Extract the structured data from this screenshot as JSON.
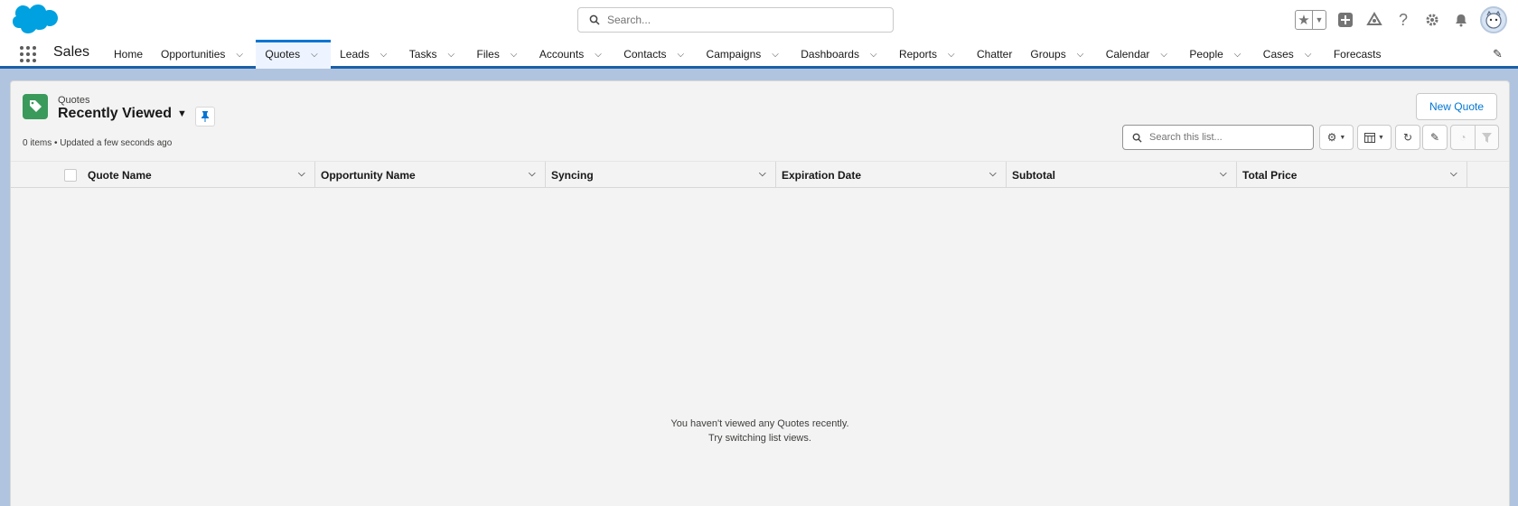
{
  "header": {
    "search_placeholder": "Search..."
  },
  "nav": {
    "app_name": "Sales",
    "items": [
      {
        "label": "Home",
        "has_menu": false,
        "active": false
      },
      {
        "label": "Opportunities",
        "has_menu": true,
        "active": false
      },
      {
        "label": "Quotes",
        "has_menu": true,
        "active": true
      },
      {
        "label": "Leads",
        "has_menu": true,
        "active": false
      },
      {
        "label": "Tasks",
        "has_menu": true,
        "active": false
      },
      {
        "label": "Files",
        "has_menu": true,
        "active": false
      },
      {
        "label": "Accounts",
        "has_menu": true,
        "active": false
      },
      {
        "label": "Contacts",
        "has_menu": true,
        "active": false
      },
      {
        "label": "Campaigns",
        "has_menu": true,
        "active": false
      },
      {
        "label": "Dashboards",
        "has_menu": true,
        "active": false
      },
      {
        "label": "Reports",
        "has_menu": true,
        "active": false
      },
      {
        "label": "Chatter",
        "has_menu": false,
        "active": false
      },
      {
        "label": "Groups",
        "has_menu": true,
        "active": false
      },
      {
        "label": "Calendar",
        "has_menu": true,
        "active": false
      },
      {
        "label": "People",
        "has_menu": true,
        "active": false
      },
      {
        "label": "Cases",
        "has_menu": true,
        "active": false
      },
      {
        "label": "Forecasts",
        "has_menu": false,
        "active": false
      }
    ]
  },
  "list": {
    "object_label": "Quotes",
    "view_name": "Recently Viewed",
    "meta": "0 items • Updated a few seconds ago",
    "new_button": "New Quote",
    "search_placeholder": "Search this list...",
    "columns": [
      "Quote Name",
      "Opportunity Name",
      "Syncing",
      "Expiration Date",
      "Subtotal",
      "Total Price"
    ],
    "empty_line1": "You haven't viewed any Quotes recently.",
    "empty_line2": "Try switching list views."
  },
  "colors": {
    "brand": "#0176d3",
    "object_icon": "#3a9a5b",
    "nav_border": "#1b5fa8"
  }
}
